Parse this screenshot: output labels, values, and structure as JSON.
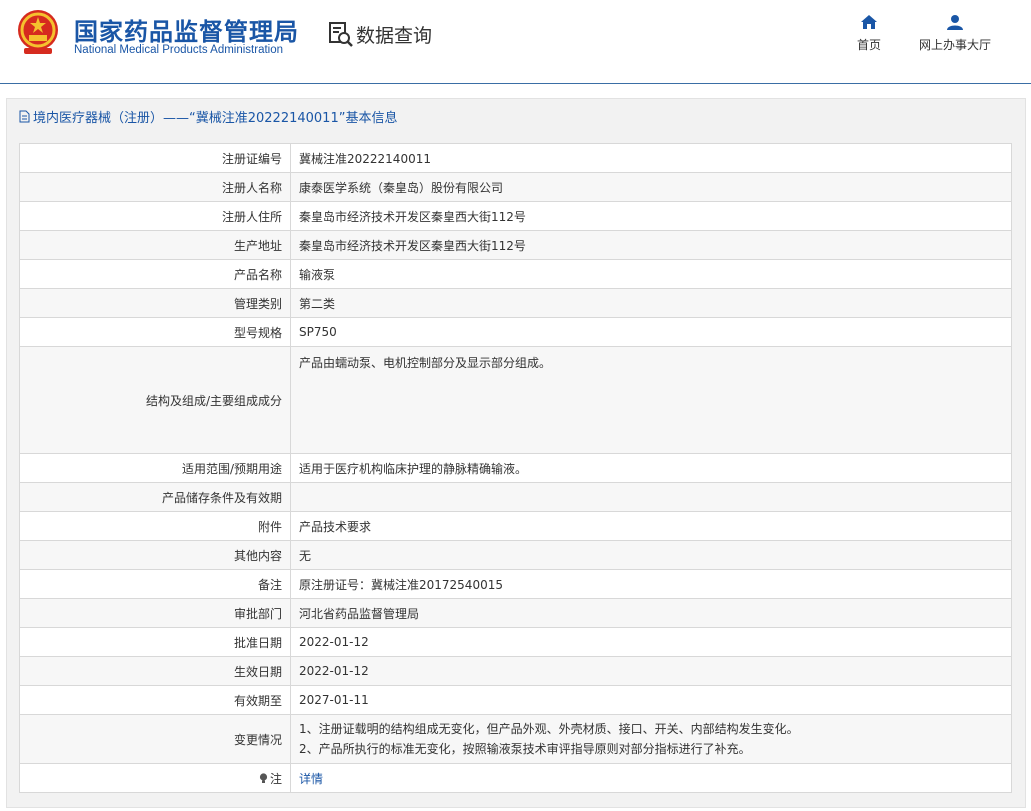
{
  "header": {
    "brand_cn": "国家药品监督管理局",
    "brand_en": "National Medical Products Administration",
    "query_label": "数据查询",
    "nav": {
      "home": "首页",
      "hall": "网上办事大厅"
    },
    "accent_color": "#1a56a6"
  },
  "panel": {
    "title": "境内医疗器械（注册）——“冀械注准20222140011”基本信息"
  },
  "record": [
    {
      "key": "注册证编号",
      "value": "冀械注准20222140011"
    },
    {
      "key": "注册人名称",
      "value": "康泰医学系统（秦皇岛）股份有限公司"
    },
    {
      "key": "注册人住所",
      "value": "秦皇岛市经济技术开发区秦皇西大街112号"
    },
    {
      "key": "生产地址",
      "value": "秦皇岛市经济技术开发区秦皇西大街112号"
    },
    {
      "key": "产品名称",
      "value": "输液泵"
    },
    {
      "key": "管理类别",
      "value": "第二类"
    },
    {
      "key": "型号规格",
      "value": "SP750"
    },
    {
      "key": "结构及组成/主要组成成分",
      "value": "产品由蠕动泵、电机控制部分及显示部分组成。"
    },
    {
      "key": "适用范围/预期用途",
      "value": "适用于医疗机构临床护理的静脉精确输液。"
    },
    {
      "key": "产品储存条件及有效期",
      "value": ""
    },
    {
      "key": "附件",
      "value": "产品技术要求"
    },
    {
      "key": "其他内容",
      "value": "无"
    },
    {
      "key": "备注",
      "value": "原注册证号：冀械注准20172540015"
    },
    {
      "key": "审批部门",
      "value": "河北省药品监督管理局"
    },
    {
      "key": "批准日期",
      "value": "2022-01-12"
    },
    {
      "key": "生效日期",
      "value": "2022-01-12"
    },
    {
      "key": "有效期至",
      "value": "2027-01-11"
    },
    {
      "key": "变更情况",
      "value_lines": [
        "1、注册证载明的结构组成无变化，但产品外观、外壳材质、接口、开关、内部结构发生变化。",
        "2、产品所执行的标准无变化，按照输液泵技术审评指导原则对部分指标进行了补充。"
      ]
    },
    {
      "key": "注",
      "value": "详情",
      "icon": "bulb-icon"
    }
  ]
}
